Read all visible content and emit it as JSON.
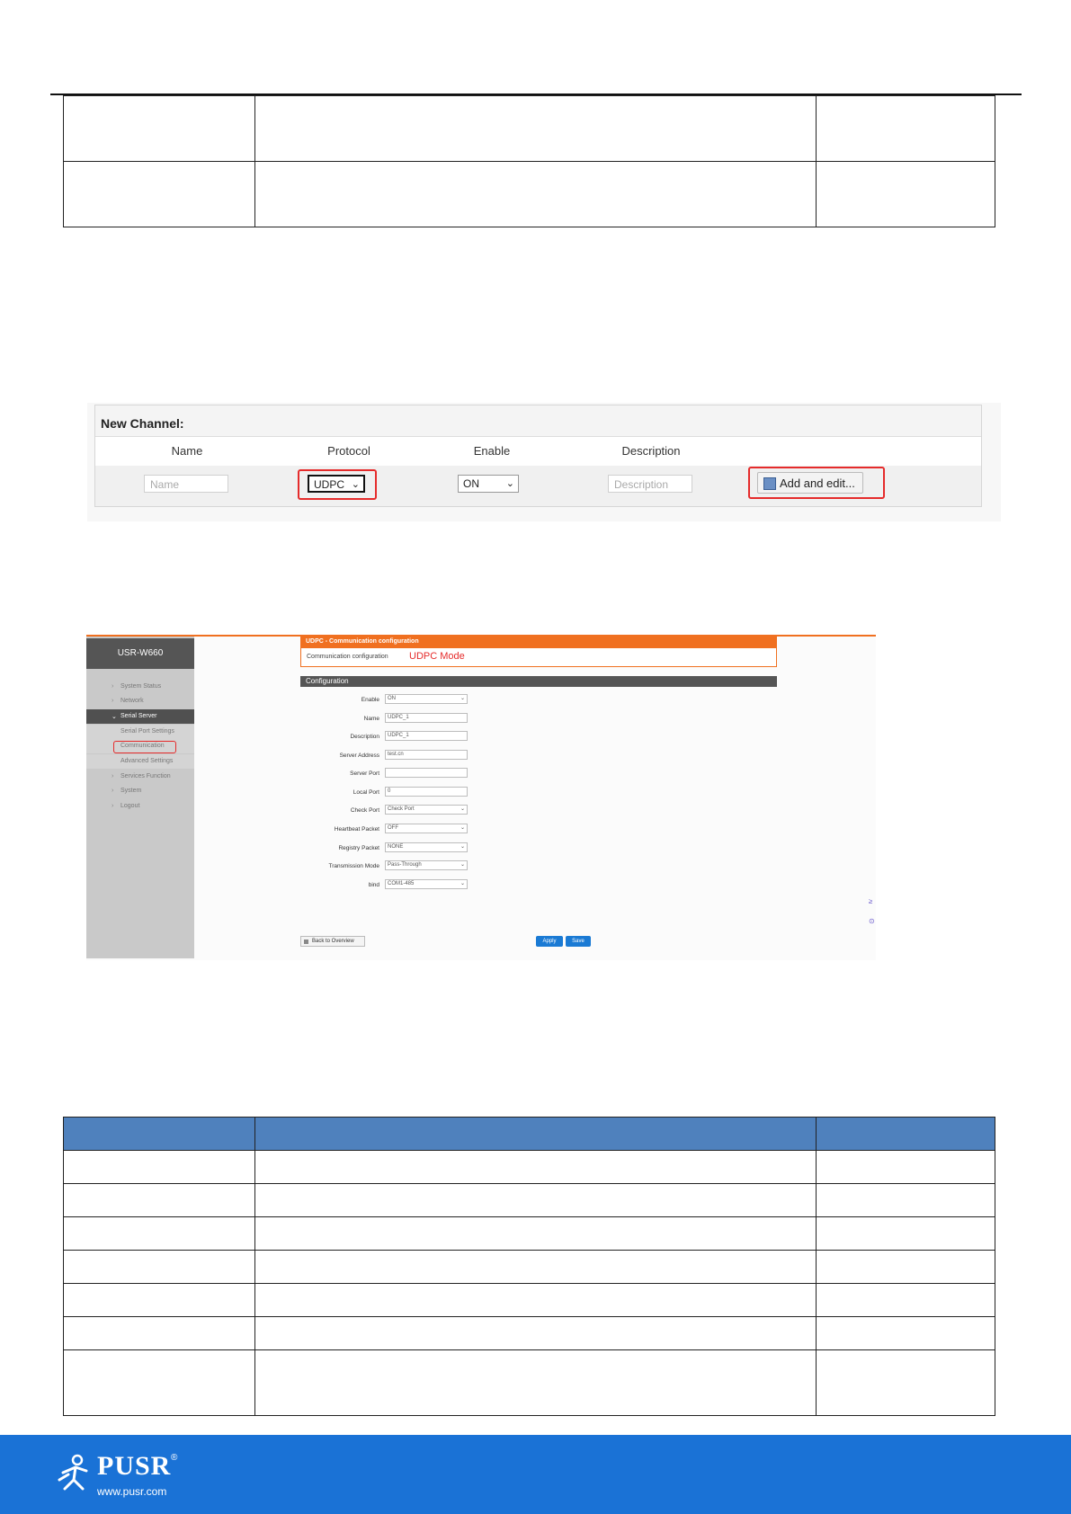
{
  "new_channel": {
    "title": "New Channel:",
    "columns": [
      "Name",
      "Protocol",
      "Enable",
      "Description"
    ],
    "name_placeholder": "Name",
    "protocol_value": "UDPC",
    "enable_value": "ON",
    "description_placeholder": "Description",
    "add_button": "Add and edit..."
  },
  "udpc": {
    "device": "USR-W660",
    "banner_title": "UDPC - Communication configuration",
    "banner_desc": "Communication configuration",
    "mode_label": "UDPC Mode",
    "section": "Configuration",
    "nav": [
      {
        "label": "System Status"
      },
      {
        "label": "Network"
      },
      {
        "label": "Serial Server"
      },
      {
        "label": "Serial Port Settings"
      },
      {
        "label": "Communication"
      },
      {
        "label": "Advanced Settings"
      },
      {
        "label": "Services Function"
      },
      {
        "label": "System"
      },
      {
        "label": "Logout"
      }
    ],
    "fields": [
      {
        "label": "Enable",
        "value": "ON"
      },
      {
        "label": "Name",
        "value": "UDPC_1"
      },
      {
        "label": "Description",
        "value": "UDPC_1"
      },
      {
        "label": "Server Address",
        "value": "test.cn"
      },
      {
        "label": "Server Port",
        "value": ""
      },
      {
        "label": "Local Port",
        "value": "0"
      },
      {
        "label": "Check Port",
        "value": "Check Port"
      },
      {
        "label": "Heartbeat Packet",
        "value": "OFF"
      },
      {
        "label": "Registry Packet",
        "value": "NONE"
      },
      {
        "label": "Transmission Mode",
        "value": "Pass-Through"
      },
      {
        "label": "bind",
        "value": "COM1-485"
      }
    ],
    "back_button": "Back to Overview",
    "apply_button": "Apply",
    "save_button": "Save",
    "edge_glyph_1": "≥",
    "edge_glyph_2": "⊙"
  },
  "footer": {
    "brand": "PUSR",
    "registered": "®",
    "url": "www.pusr.com"
  }
}
